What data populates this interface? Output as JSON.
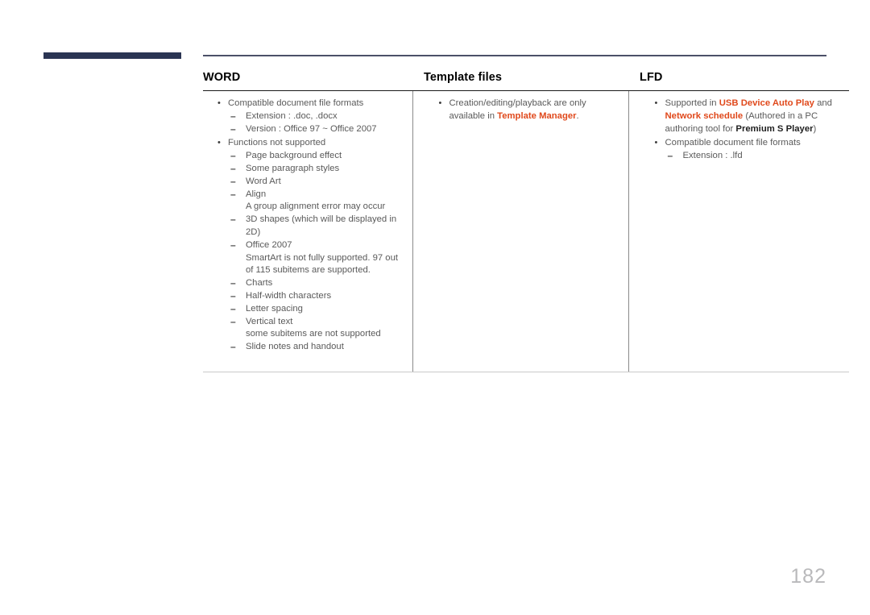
{
  "page": {
    "number": "182",
    "accent_navy": "#2b3553",
    "accent_orange": "#e0491c",
    "body_text_color": "#5a5a5a"
  },
  "table": {
    "headers": [
      {
        "label": "WORD"
      },
      {
        "label": "Template files"
      },
      {
        "label": "LFD"
      }
    ],
    "columns": [
      {
        "key": "word",
        "items": [
          {
            "text": "Compatible document file formats",
            "subitems": [
              {
                "text": "Extension : .doc, .docx"
              },
              {
                "text": "Version : Office 97 ~ Office 2007"
              }
            ]
          },
          {
            "text": "Functions not supported",
            "subitems": [
              {
                "text": "Page background effect"
              },
              {
                "text": "Some paragraph styles"
              },
              {
                "text": "Word Art"
              },
              {
                "text": "Align",
                "note": "A group alignment error may occur"
              },
              {
                "text": "3D shapes (which will be displayed in 2D)"
              },
              {
                "text": "Office 2007",
                "note": "SmartArt is not fully supported. 97 out of 115 subitems are supported."
              },
              {
                "text": "Charts"
              },
              {
                "text": "Half-width characters"
              },
              {
                "text": "Letter spacing"
              },
              {
                "text": "Vertical text",
                "note": "some subitems are not supported"
              },
              {
                "text": "Slide notes and handout"
              }
            ]
          }
        ]
      },
      {
        "key": "template_files",
        "items": [
          {
            "rich": [
              {
                "t": "Creation/editing/playback are only available in ",
                "s": "plain"
              },
              {
                "t": "Template Manager",
                "s": "highlight"
              },
              {
                "t": ".",
                "s": "plain"
              }
            ],
            "subitems": []
          }
        ]
      },
      {
        "key": "lfd",
        "items": [
          {
            "rich": [
              {
                "t": "Supported in ",
                "s": "plain"
              },
              {
                "t": "USB Device Auto Play",
                "s": "highlight"
              },
              {
                "t": " and ",
                "s": "plain"
              },
              {
                "t": "Network schedule",
                "s": "highlight"
              },
              {
                "t": " (Authored in a PC authoring tool for ",
                "s": "plain"
              },
              {
                "t": "Premium S Player",
                "s": "bold"
              },
              {
                "t": ")",
                "s": "plain"
              }
            ],
            "subitems": []
          },
          {
            "text": "Compatible document file formats",
            "subitems": [
              {
                "text": "Extension : .lfd"
              }
            ]
          }
        ]
      }
    ]
  }
}
